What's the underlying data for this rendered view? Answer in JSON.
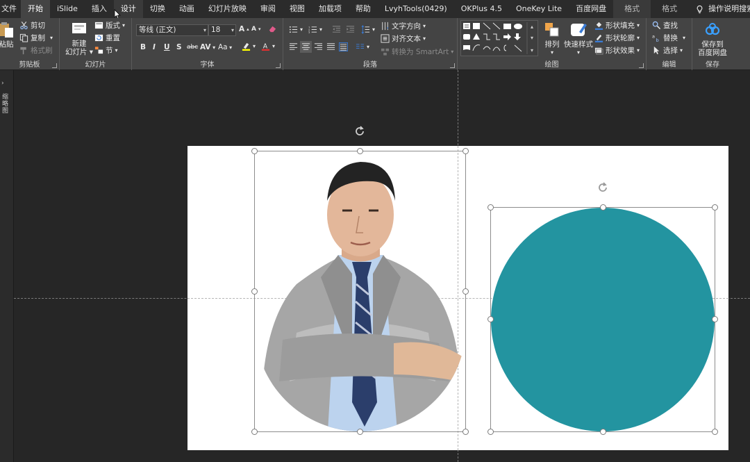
{
  "tabs": [
    {
      "label": "文件"
    },
    {
      "label": "开始"
    },
    {
      "label": "iSlide"
    },
    {
      "label": "插入"
    },
    {
      "label": "设计"
    },
    {
      "label": "切换"
    },
    {
      "label": "动画"
    },
    {
      "label": "幻灯片放映"
    },
    {
      "label": "审阅"
    },
    {
      "label": "视图"
    },
    {
      "label": "加载项"
    },
    {
      "label": "帮助"
    },
    {
      "label": "LvyhTools(0429)"
    },
    {
      "label": "OKPlus 4.5"
    },
    {
      "label": "OneKey Lite"
    },
    {
      "label": "百度网盘"
    },
    {
      "label": "格式"
    },
    {
      "label": "格式"
    }
  ],
  "help_search": "操作说明搜索",
  "ribbon": {
    "clipboard": {
      "paste": "粘贴",
      "cut": "剪切",
      "copy": "复制",
      "format_painter": "格式刷",
      "label": "剪贴板"
    },
    "slides": {
      "new_slide_line1": "新建",
      "new_slide_line2": "幻灯片",
      "layout": "版式",
      "reset": "重置",
      "section": "节",
      "label": "幻灯片"
    },
    "font": {
      "font_name": "等线 (正文)",
      "font_size": "18",
      "bold": "B",
      "italic": "I",
      "underline": "U",
      "shadow": "S",
      "strike": "abc",
      "spacing": "AV",
      "case": "Aa",
      "label": "字体"
    },
    "paragraph": {
      "text_direction": "文字方向",
      "align_text": "对齐文本",
      "smartart": "转换为 SmartArt",
      "label": "段落"
    },
    "drawing": {
      "arrange": "排列",
      "quick_styles": "快速样式",
      "shape_fill": "形状填充",
      "shape_outline": "形状轮廓",
      "shape_effects": "形状效果",
      "label": "绘图"
    },
    "editing": {
      "find": "查找",
      "replace": "替换",
      "select": "选择",
      "label": "编辑"
    },
    "save": {
      "line1": "保存到",
      "line2": "百度网盘",
      "label": "保存"
    }
  },
  "left_pane_label": "缩略图",
  "colors": {
    "accent": "#2394a0",
    "tab_active": "#444444",
    "ribbon_bg": "#444444",
    "workspace": "#262626"
  }
}
